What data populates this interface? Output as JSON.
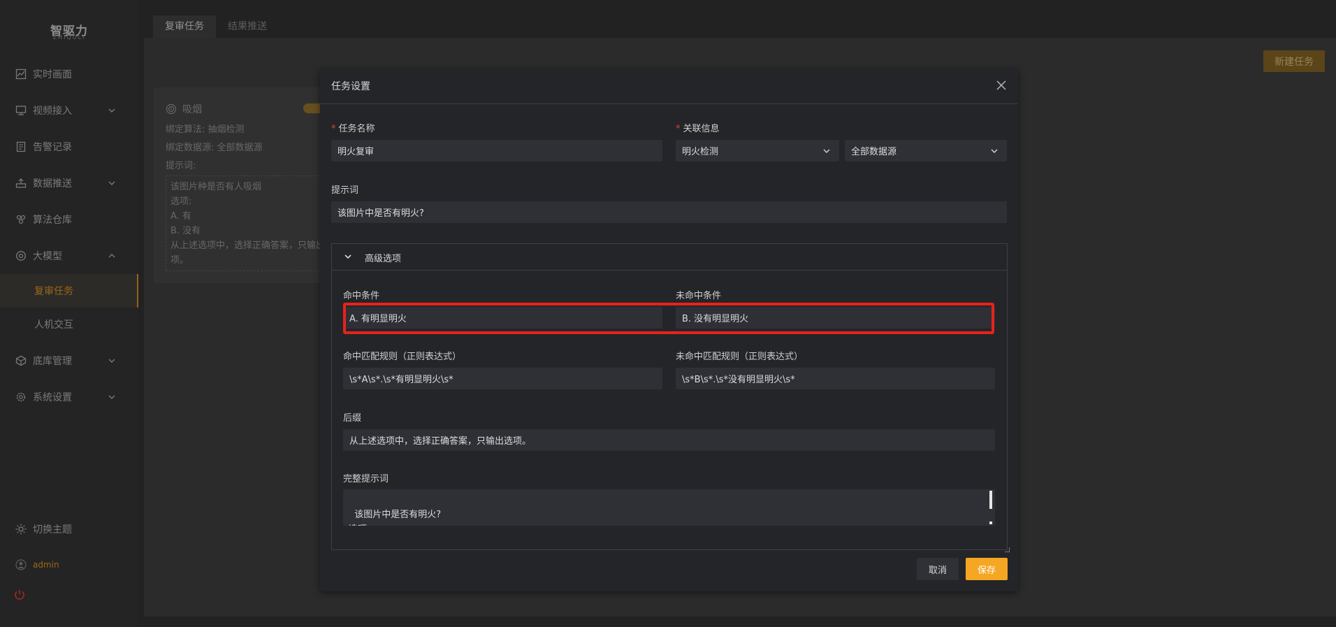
{
  "brand": {
    "name": "智驱力",
    "sub": "ZHIQULI"
  },
  "sidebar": {
    "items": [
      {
        "label": "实时画面",
        "icon": "chart-line-icon",
        "expandable": false
      },
      {
        "label": "视频接入",
        "icon": "monitor-icon",
        "expandable": true
      },
      {
        "label": "告警记录",
        "icon": "document-icon",
        "expandable": false
      },
      {
        "label": "数据推送",
        "icon": "upload-icon",
        "expandable": true
      },
      {
        "label": "算法仓库",
        "icon": "cube-cluster-icon",
        "expandable": false
      },
      {
        "label": "大模型",
        "icon": "model-icon",
        "expandable": true
      },
      {
        "label": "底库管理",
        "icon": "box-icon",
        "expandable": true
      },
      {
        "label": "系统设置",
        "icon": "gear-icon",
        "expandable": true
      }
    ],
    "sub_items": [
      "复审任务",
      "人机交互"
    ],
    "theme_label": "切换主题",
    "user": "admin"
  },
  "tabs": [
    "复审任务",
    "结果推送"
  ],
  "new_task_label": "新建任务",
  "card": {
    "title": "吸烟",
    "algo_label": "绑定算法:",
    "algo_value": "抽烟检测",
    "source_label": "绑定数据源:",
    "source_value": "全部数据源",
    "prompt_label": "提示词:",
    "prompt_text": "该图片种是否有人吸烟\n选项:\nA. 有\nB. 没有\n从上述选项中，选择正确答案，只输出选\n项。"
  },
  "modal": {
    "title": "任务设置",
    "task_name_label": "任务名称",
    "task_name_value": "明火复审",
    "related_label": "关联信息",
    "related_algo": "明火检测",
    "related_source": "全部数据源",
    "prompt_label": "提示词",
    "prompt_value": "该图片中是否有明火?",
    "advanced_label": "高级选项",
    "hit_label": "命中条件",
    "hit_value": "A. 有明显明火",
    "miss_label": "未命中条件",
    "miss_value": "B. 没有明显明火",
    "hit_regex_label": "命中匹配规则（正则表达式）",
    "hit_regex_value": "\\s*A\\s*.\\s*有明显明火\\s*",
    "miss_regex_label": "未命中匹配规则（正则表达式）",
    "miss_regex_value": "\\s*B\\s*.\\s*没有明显明火\\s*",
    "suffix_label": "后缀",
    "suffix_value": "从上述选项中，选择正确答案，只输出选项。",
    "full_prompt_label": "完整提示词",
    "full_prompt_value": "该图片中是否有明火?\n选项:",
    "cancel_label": "取消",
    "save_label": "保存"
  },
  "colors": {
    "accent": "#f5a623",
    "highlight": "#e8221b",
    "sidebar_active": "#d08a20"
  }
}
